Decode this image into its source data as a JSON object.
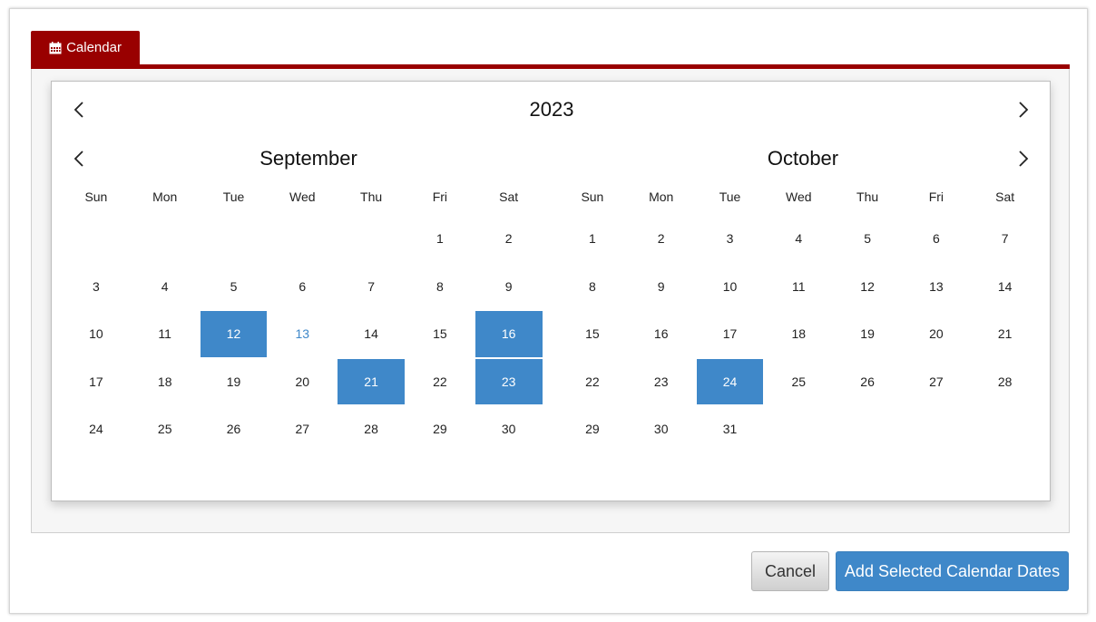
{
  "tab": {
    "label": "Calendar",
    "icon": "calendar-icon"
  },
  "calendar": {
    "year": "2023",
    "weekdays": [
      "Sun",
      "Mon",
      "Tue",
      "Wed",
      "Thu",
      "Fri",
      "Sat"
    ],
    "months": [
      {
        "name": "September",
        "weeks": [
          [
            "",
            "",
            "",
            "",
            "",
            "1",
            "2"
          ],
          [
            "3",
            "4",
            "5",
            "6",
            "7",
            "8",
            "9"
          ],
          [
            "10",
            "11",
            "12",
            "13",
            "14",
            "15",
            "16"
          ],
          [
            "17",
            "18",
            "19",
            "20",
            "21",
            "22",
            "23"
          ],
          [
            "24",
            "25",
            "26",
            "27",
            "28",
            "29",
            "30"
          ]
        ],
        "selected": [
          "12",
          "16",
          "21",
          "23"
        ],
        "today": "13"
      },
      {
        "name": "October",
        "weeks": [
          [
            "1",
            "2",
            "3",
            "4",
            "5",
            "6",
            "7"
          ],
          [
            "8",
            "9",
            "10",
            "11",
            "12",
            "13",
            "14"
          ],
          [
            "15",
            "16",
            "17",
            "18",
            "19",
            "20",
            "21"
          ],
          [
            "22",
            "23",
            "24",
            "25",
            "26",
            "27",
            "28"
          ],
          [
            "29",
            "30",
            "31",
            "",
            "",
            "",
            ""
          ]
        ],
        "selected": [
          "24"
        ],
        "today": ""
      }
    ]
  },
  "buttons": {
    "cancel": "Cancel",
    "add": "Add Selected Calendar Dates"
  },
  "colors": {
    "brand": "#990000",
    "selected": "#3f88c9"
  }
}
